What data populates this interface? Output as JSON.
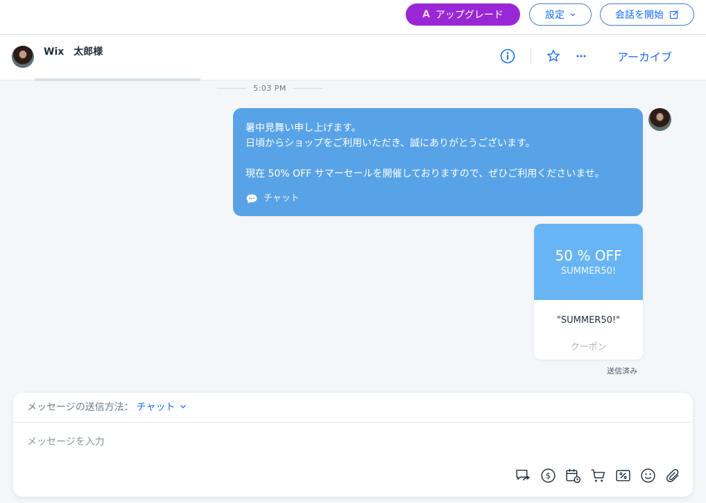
{
  "topbar": {
    "upgrade_label": "アップグレード",
    "upgrade_icon": "A",
    "settings_label": "設定",
    "start_chat_label": "会話を開始"
  },
  "header": {
    "contact_name": "Wix　太郎様",
    "archive_label": "アーカイブ"
  },
  "thread": {
    "time": "5:03 PM",
    "message": {
      "lines": [
        "暑中見舞い申し上げます。",
        "日頃からショップをご利用いただき、誠にありがとうございます。",
        "",
        "現在 50% OFF サマーセールを開催しておりますので、ぜひご利用くださいませ。"
      ],
      "channel": "チャット"
    },
    "coupon": {
      "headline": "50 % OFF",
      "code_small": "SUMMER50!",
      "code": "\"SUMMER50!\"",
      "label": "クーポン"
    },
    "status": "送信済み"
  },
  "composer": {
    "method_label": "メッセージの送信方法：",
    "method_value": "チャット",
    "placeholder": "メッセージを入力"
  },
  "colors": {
    "accent": "#116dff",
    "upgrade": "#9a27d5",
    "bubble": "#58a3e8",
    "coupon": "#67b5f5"
  }
}
